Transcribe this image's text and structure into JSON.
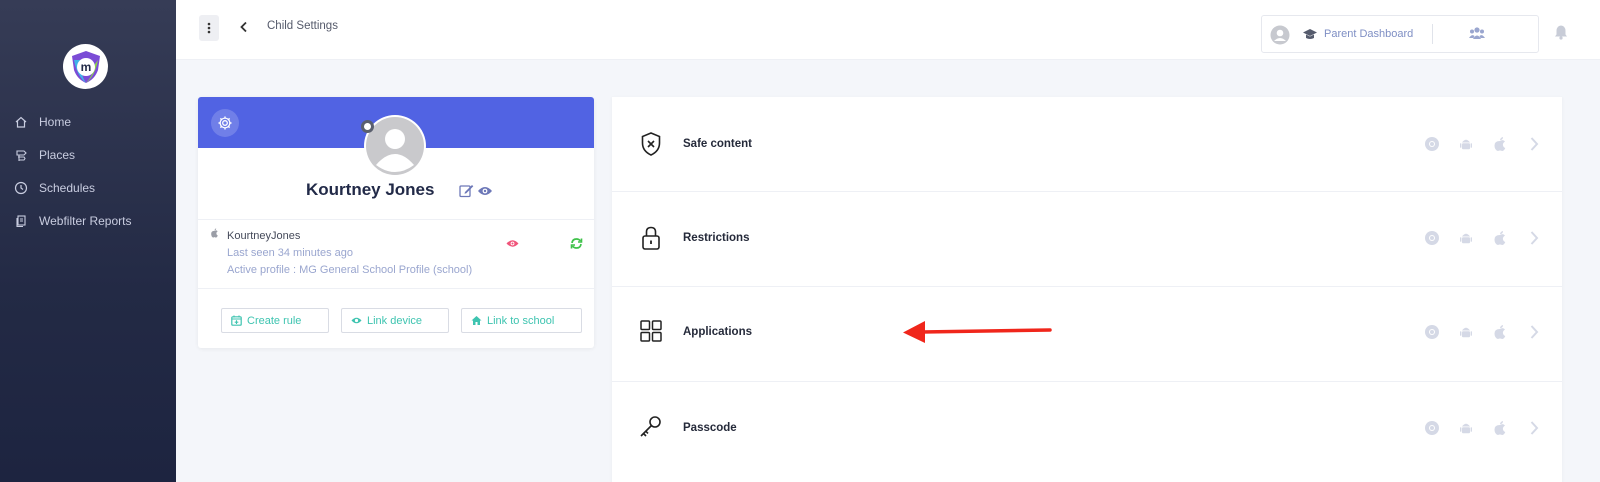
{
  "sidebar": {
    "items": [
      {
        "label": "Home",
        "icon": "home-icon"
      },
      {
        "label": "Places",
        "icon": "places-icon"
      },
      {
        "label": "Schedules",
        "icon": "clock-icon"
      },
      {
        "label": "Webfilter Reports",
        "icon": "report-icon"
      }
    ]
  },
  "topbar": {
    "page_title": "Child Settings",
    "parent_dashboard": "Parent Dashboard"
  },
  "profile": {
    "name": "Kourtney Jones",
    "username": "KourtneyJones",
    "last_seen": "Last seen 34 minutes ago",
    "active_profile": "Active profile : MG General School Profile (school)",
    "buttons": {
      "create_rule": "Create rule",
      "link_device": "Link device",
      "link_school": "Link to school"
    }
  },
  "settings": [
    {
      "label": "Safe content",
      "icon": "shield-x-icon"
    },
    {
      "label": "Restrictions",
      "icon": "lock-icon"
    },
    {
      "label": "Applications",
      "icon": "grid-icon"
    },
    {
      "label": "Passcode",
      "icon": "key-icon"
    }
  ],
  "colors": {
    "accent": "#5163e3",
    "sidebar": "#232a45",
    "button_text": "#3ec4b0",
    "arrow": "#f0261b"
  }
}
